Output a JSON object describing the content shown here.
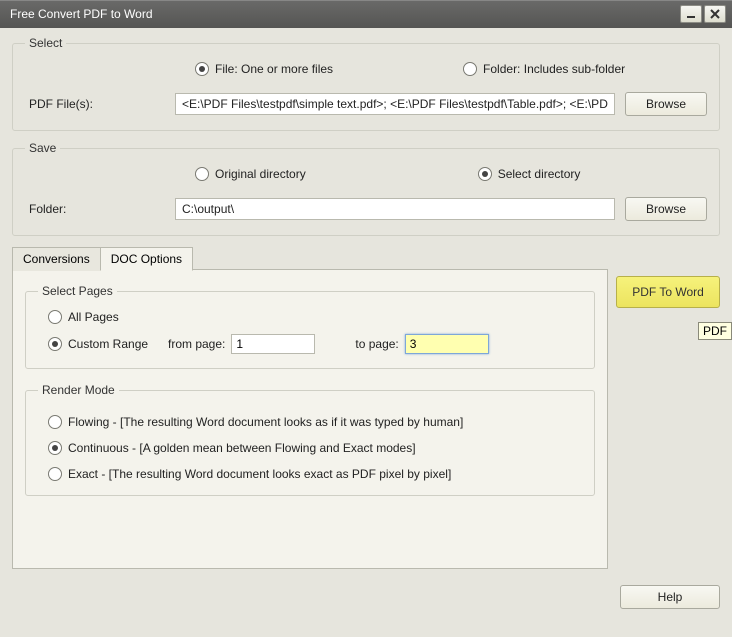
{
  "window": {
    "title": "Free Convert PDF to Word"
  },
  "select": {
    "legend": "Select",
    "radio_file": "File:  One or more files",
    "radio_folder": "Folder: Includes sub-folder",
    "file_selected": true,
    "files_label": "PDF File(s):",
    "files_value": "<E:\\PDF Files\\testpdf\\simple text.pdf>; <E:\\PDF Files\\testpdf\\Table.pdf>; <E:\\PDF",
    "browse": "Browse"
  },
  "save": {
    "legend": "Save",
    "radio_original": "Original directory",
    "radio_select": "Select directory",
    "select_selected": true,
    "folder_label": "Folder:",
    "folder_value": "C:\\output\\",
    "browse": "Browse"
  },
  "tabs": {
    "conversions": "Conversions",
    "doc_options": "DOC Options",
    "active": "doc_options"
  },
  "select_pages": {
    "legend": "Select Pages",
    "all": "All Pages",
    "custom": "Custom Range",
    "custom_selected": true,
    "from_label": "from page:",
    "from_value": "1",
    "to_label": "to page:",
    "to_value": "3"
  },
  "render_mode": {
    "legend": "Render Mode",
    "flowing": "Flowing - [The resulting Word document looks as if it was typed by human]",
    "continuous": "Continuous - [A golden mean between Flowing and Exact modes]",
    "exact": "Exact - [The resulting Word document looks exact as PDF pixel by pixel]",
    "selected": "continuous"
  },
  "actions": {
    "convert": "PDF To Word",
    "help": "Help"
  },
  "tooltip": "PDF"
}
